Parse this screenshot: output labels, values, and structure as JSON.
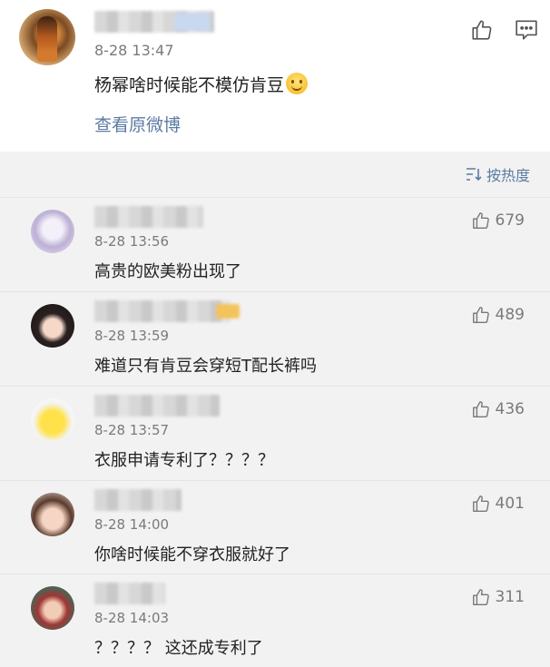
{
  "post": {
    "time": "8-28 13:47",
    "content": "杨幂啥时候能不模仿肯豆",
    "view_original": "查看原微博",
    "icons": {
      "like": "thumbs-up-icon",
      "comment": "comment-icon",
      "emoji": "smile-emoji-icon"
    }
  },
  "sort": {
    "label": "按热度",
    "icon": "sort-icon"
  },
  "comments": [
    {
      "time": "8-28 13:56",
      "text": "高贵的欧美粉出现了",
      "likes": "679"
    },
    {
      "time": "8-28 13:59",
      "text": "难道只有肯豆会穿短T配长裤吗",
      "likes": "489"
    },
    {
      "time": "8-28 13:57",
      "text": "衣服申请专利了？？？？",
      "likes": "436"
    },
    {
      "time": "8-28 14:00",
      "text": "你啥时候能不穿衣服就好了",
      "likes": "401"
    },
    {
      "time": "8-28 14:03",
      "text": "？？？？ 这还成专利了",
      "likes": "311"
    }
  ],
  "colors": {
    "link": "#5b7ba3",
    "meta": "#7a7a7a",
    "text": "#222222",
    "background": "#f2f2f2"
  }
}
